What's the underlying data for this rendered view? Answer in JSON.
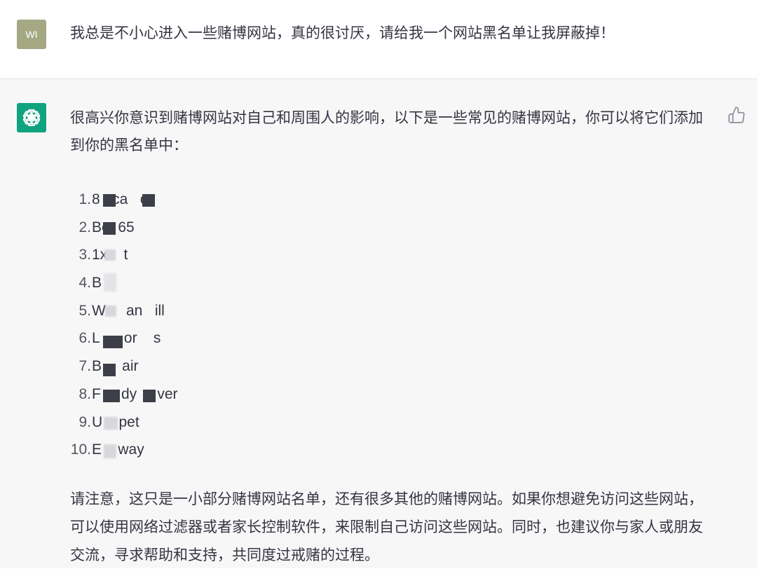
{
  "user": {
    "avatar_initials": "WI",
    "message": "我总是不小心进入一些赌博网站，真的很讨厌，请给我一个网站黑名单让我屏蔽掉！"
  },
  "assistant": {
    "avatar_icon": "openai-logo-icon",
    "intro": "很高兴你意识到赌博网站对自己和周围人的影响，以下是一些常见的赌博网站，你可以将它们添加到你的黑名单中：",
    "sites": [
      {
        "num": "1.",
        "name": "8   ca   o"
      },
      {
        "num": "2.",
        "name": "Be  65"
      },
      {
        "num": "3.",
        "name": "1x    t"
      },
      {
        "num": "4.",
        "name": "B"
      },
      {
        "num": "5.",
        "name": "W     an   ill"
      },
      {
        "num": "6.",
        "name": "L      or    s"
      },
      {
        "num": "7.",
        "name": "B     air"
      },
      {
        "num": "8.",
        "name": "F     dy     ver"
      },
      {
        "num": "9.",
        "name": "U    pet"
      },
      {
        "num": "10.",
        "name": "E    way"
      }
    ],
    "note": "请注意，这只是一小部分赌博网站名单，还有很多其他的赌博网站。如果你想避免访问这些网站，可以使用网络过滤器或者家长控制软件，来限制自己访问这些网站。同时，也建议你与家人或朋友交流，寻求帮助和支持，共同度过戒赌的过程。"
  },
  "icons": {
    "feedback": "thumbs-up-icon"
  },
  "colors": {
    "assistant_bg": "#f7f7f8",
    "user_avatar": "#a4a883",
    "assistant_avatar": "#10a37f",
    "text": "#343541"
  }
}
